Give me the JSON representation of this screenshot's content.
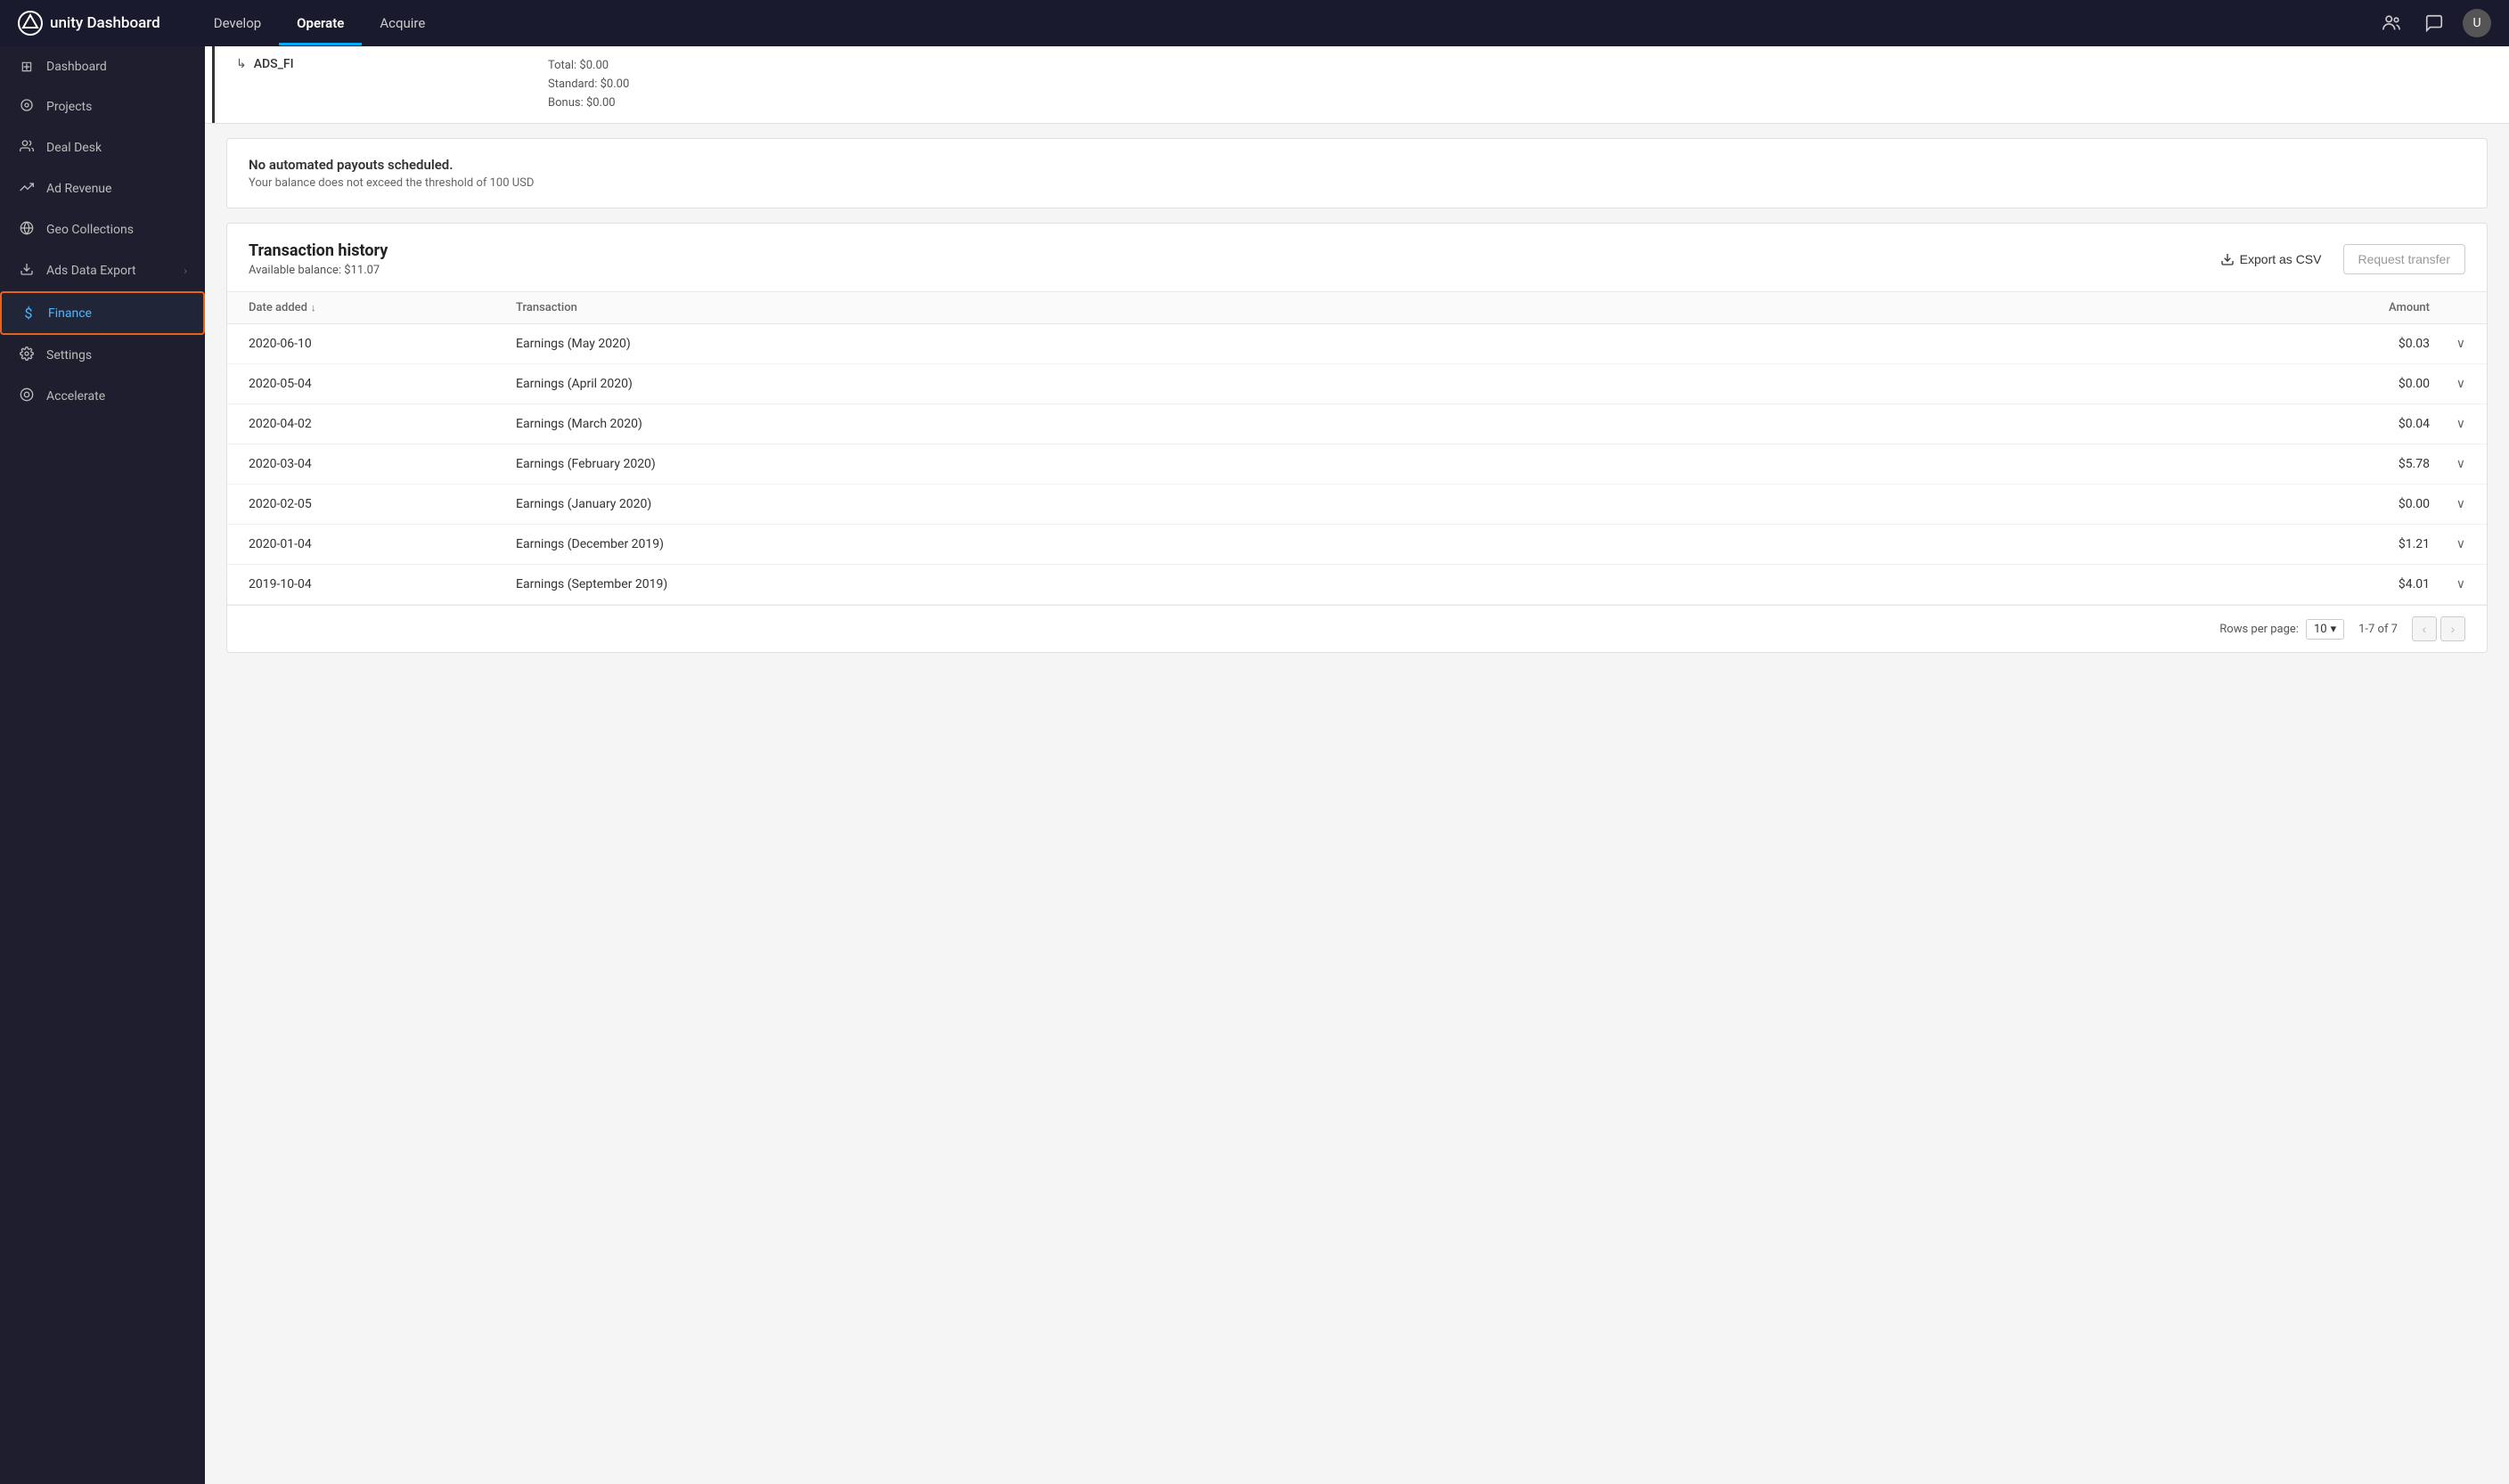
{
  "app": {
    "title": "unity Dashboard",
    "logo_text": "unity Dashboard"
  },
  "top_nav": {
    "links": [
      {
        "label": "Develop",
        "active": false
      },
      {
        "label": "Operate",
        "active": true
      },
      {
        "label": "Acquire",
        "active": false
      }
    ],
    "icons": [
      "people-icon",
      "chat-icon",
      "user-avatar-icon"
    ]
  },
  "sidebar": {
    "items": [
      {
        "id": "dashboard",
        "label": "Dashboard",
        "icon": "⊞"
      },
      {
        "id": "projects",
        "label": "Projects",
        "icon": "◉"
      },
      {
        "id": "deal-desk",
        "label": "Deal Desk",
        "icon": "👥"
      },
      {
        "id": "ad-revenue",
        "label": "Ad Revenue",
        "icon": "↗"
      },
      {
        "id": "geo-collections",
        "label": "Geo Collections",
        "icon": "🌐"
      },
      {
        "id": "ads-data-export",
        "label": "Ads Data Export",
        "icon": "⬇",
        "has_chevron": true
      },
      {
        "id": "finance",
        "label": "Finance",
        "icon": "$",
        "active": true
      },
      {
        "id": "settings",
        "label": "Settings",
        "icon": "⚙"
      },
      {
        "id": "accelerate",
        "label": "Accelerate",
        "icon": "◎"
      }
    ]
  },
  "partial_top": {
    "name": "ADS_FI",
    "total": "Total: $0.00",
    "standard": "Standard: $0.00",
    "bonus": "Bonus: $0.00"
  },
  "alert": {
    "title": "No automated payouts scheduled.",
    "subtitle": "Your balance does not exceed the threshold of 100 USD"
  },
  "transaction_history": {
    "title": "Transaction history",
    "available_balance_label": "Available balance:",
    "available_balance": "$11.07",
    "export_label": "Export as CSV",
    "request_label": "Request transfer",
    "columns": [
      {
        "id": "date",
        "label": "Date added",
        "sortable": true
      },
      {
        "id": "transaction",
        "label": "Transaction",
        "sortable": false
      },
      {
        "id": "amount",
        "label": "Amount",
        "sortable": false
      }
    ],
    "rows": [
      {
        "date": "2020-06-10",
        "transaction": "Earnings (May 2020)",
        "amount": "$0.03"
      },
      {
        "date": "2020-05-04",
        "transaction": "Earnings (April 2020)",
        "amount": "$0.00"
      },
      {
        "date": "2020-04-02",
        "transaction": "Earnings (March 2020)",
        "amount": "$0.04"
      },
      {
        "date": "2020-03-04",
        "transaction": "Earnings (February 2020)",
        "amount": "$5.78"
      },
      {
        "date": "2020-02-05",
        "transaction": "Earnings (January 2020)",
        "amount": "$0.00"
      },
      {
        "date": "2020-01-04",
        "transaction": "Earnings (December 2019)",
        "amount": "$1.21"
      },
      {
        "date": "2019-10-04",
        "transaction": "Earnings (September 2019)",
        "amount": "$4.01"
      }
    ],
    "pagination": {
      "rows_per_page_label": "Rows per page:",
      "rows_per_page": "10",
      "page_info": "1-7 of 7"
    }
  }
}
